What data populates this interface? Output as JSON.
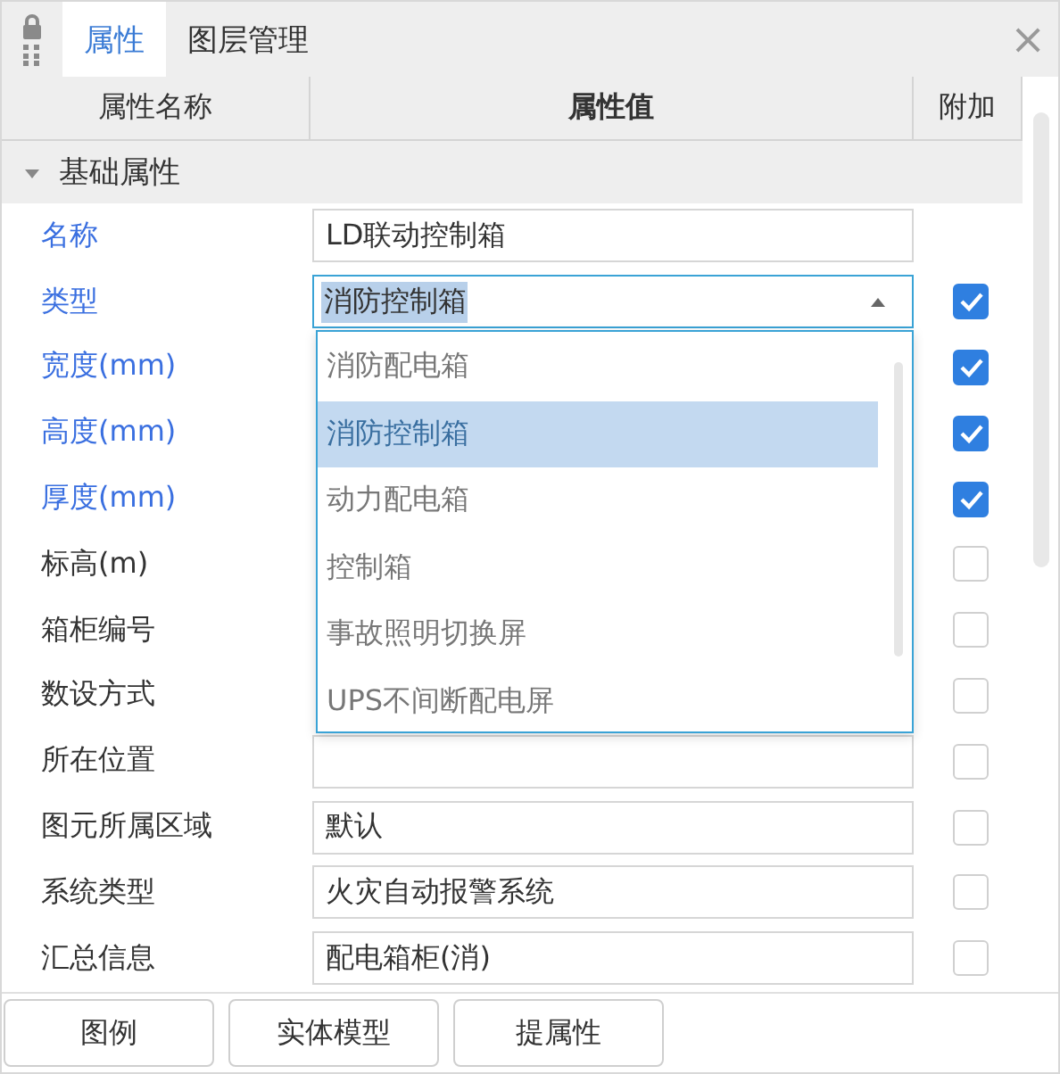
{
  "tabs": [
    {
      "label": "属性",
      "selected": true
    },
    {
      "label": "图层管理",
      "selected": false
    }
  ],
  "close": "×",
  "table": {
    "columns": [
      "属性名称",
      "属性值",
      "附加"
    ],
    "group": {
      "label": "基础属性",
      "expanded": true
    },
    "rows": [
      {
        "name": "名称",
        "emphasis": true,
        "kind": "text",
        "value": "LD联动控制箱"
      },
      {
        "name": "类型",
        "emphasis": true,
        "kind": "combo",
        "value": "消防控制箱",
        "expanded": true,
        "checked": true
      },
      {
        "name": "宽度(mm)",
        "emphasis": true,
        "kind": "text",
        "checked": true
      },
      {
        "name": "高度(mm)",
        "emphasis": true,
        "kind": "text",
        "checked": true
      },
      {
        "name": "厚度(mm)",
        "emphasis": true,
        "kind": "text",
        "checked": true
      },
      {
        "name": "标高(m)",
        "emphasis": false,
        "kind": "text",
        "checked": false
      },
      {
        "name": "箱柜编号",
        "emphasis": false,
        "kind": "text",
        "checked": false
      },
      {
        "name": "数设方式",
        "emphasis": false,
        "kind": "text",
        "checked": false
      },
      {
        "name": "所在位置",
        "emphasis": false,
        "kind": "text",
        "checked": false
      },
      {
        "name": "图元所属区域",
        "emphasis": false,
        "kind": "text",
        "value": "默认",
        "checked": false
      },
      {
        "name": "系统类型",
        "emphasis": false,
        "kind": "text",
        "value": "火灾自动报警系统",
        "checked": false
      },
      {
        "name": "汇总信息",
        "emphasis": false,
        "kind": "text",
        "value": "配电箱柜(消)",
        "checked": false
      }
    ]
  },
  "dropdown": {
    "options": [
      {
        "label": "消防配电箱",
        "selected": false
      },
      {
        "label": "消防控制箱",
        "selected": true
      },
      {
        "label": "动力配电箱",
        "selected": false
      },
      {
        "label": "控制箱",
        "selected": false
      },
      {
        "label": "事故照明切换屏",
        "selected": false
      },
      {
        "label": "UPS不间断配电屏",
        "selected": false
      }
    ]
  },
  "buttons": [
    "图例",
    "实体模型",
    "提属性"
  ]
}
